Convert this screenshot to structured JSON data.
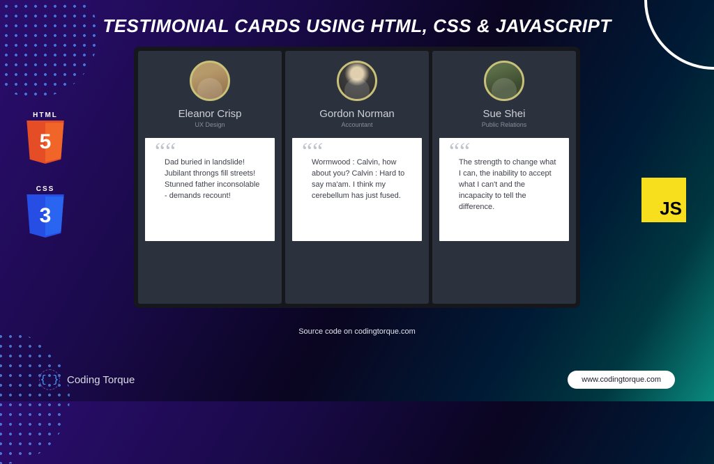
{
  "page_title": "TESTIMONIAL CARDS USING HTML, CSS & JAVASCRIPT",
  "logos": {
    "html": {
      "label": "HTML",
      "glyph": "5"
    },
    "css": {
      "label": "CSS",
      "glyph": "3"
    },
    "js": {
      "glyph": "JS"
    }
  },
  "cards": [
    {
      "name": "Eleanor Crisp",
      "role": "UX Design",
      "quote": "Dad buried in landslide! Jubilant throngs fill streets! Stunned father inconsolable - demands recount!"
    },
    {
      "name": "Gordon Norman",
      "role": "Accountant",
      "quote": "Wormwood : Calvin, how about you? Calvin : Hard to say ma'am. I think my cerebellum has just fused."
    },
    {
      "name": "Sue Shei",
      "role": "Public Relations",
      "quote": "The strength to change what I can, the inability to accept what I can't and the incapacity to tell the difference."
    }
  ],
  "quote_mark": "““",
  "footer": {
    "source_line": "Source code on codingtorque.com",
    "brand": "Coding Torque",
    "brand_glyph": "{ }",
    "site_button": "www.codingtorque.com"
  }
}
